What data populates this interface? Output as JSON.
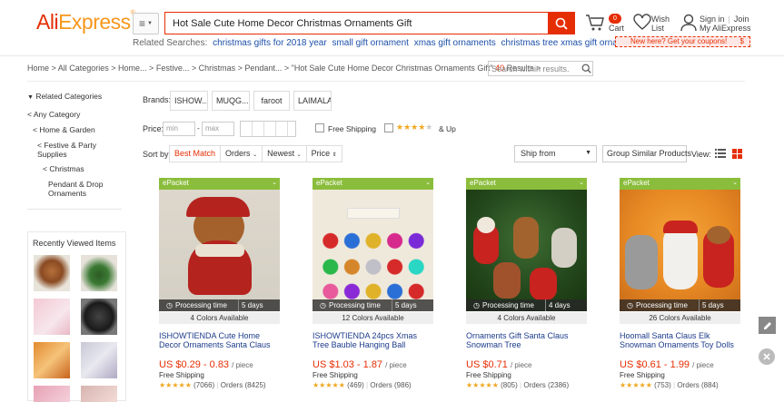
{
  "header": {
    "logo_part1": "Ali",
    "logo_part2": "Express",
    "logo_tm": "®",
    "category_icon": "menu-icon",
    "search_value": "Hot Sale Cute Home Decor Christmas Ornaments Gift",
    "related_label": "Related Searches:",
    "related": [
      "christmas gifts for 2018 year",
      "small gift ornament",
      "xmas gift ornaments",
      "christmas tree xmas gift ornament"
    ],
    "cart_label": "Cart",
    "cart_count": "0",
    "wish_line1": "Wish",
    "wish_line2": "List",
    "sign_in": "Sign in",
    "join": "Join",
    "my_account": "My AliExpress",
    "coupon_text": "New here? Get your coupons!",
    "coupon_symbol": "$"
  },
  "breadcrumb": {
    "path": "Home > All Categories > Home... > Festive... > Christmas > Pendant... > \"Hot Sale Cute Home Decor Christmas Ornaments Gift\"",
    "count": "40",
    "results_label": "Results >",
    "within_placeholder": "Search within results."
  },
  "sidebar": {
    "related_title": "Related Categories",
    "categories": [
      "< Any Category",
      "< Home & Garden",
      "< Festive & Party",
      "Supplies",
      "< Christmas",
      "Pendant & Drop",
      "Ornaments"
    ],
    "recent_title": "Recently Viewed Items"
  },
  "filters": {
    "brands_label": "Brands:",
    "brands": [
      "ISHOW...",
      "MUQG...",
      "faroot",
      "LAIMALA"
    ],
    "price_label": "Price:",
    "min_placeholder": "min",
    "dash": "-",
    "max_placeholder": "max",
    "free_shipping": "Free Shipping",
    "up_label": "& Up",
    "sort_label": "Sort by:",
    "sort_options": [
      "Best Match",
      "Orders",
      "Newest",
      "Price"
    ],
    "ship_from": "Ship from",
    "group_similar": "Group Similar Products",
    "view_label": "View:"
  },
  "products": [
    {
      "badge": "ePacket",
      "processing": "Processing time",
      "days": "5 days",
      "colors": "4 Colors Available",
      "title": "ISHOWTIENDA Cute Home Decor Ornaments Santa Claus",
      "price": "US $0.29 - 0.83",
      "unit": "/ piece",
      "shipping": "Free Shipping",
      "stars": "★★★★★",
      "reviews": "(7066)",
      "orders": "Orders (8425)"
    },
    {
      "badge": "ePacket",
      "processing": "Processing time",
      "days": "5 days",
      "colors": "12 Colors Available",
      "title": "ISHOWTIENDA 24pcs Xmas Tree Bauble Hanging Ball Wedding",
      "price": "US $1.03 - 1.87",
      "unit": "/ piece",
      "shipping": "Free Shipping",
      "stars": "★★★★★",
      "reviews": "(469)",
      "orders": "Orders (986)"
    },
    {
      "badge": "ePacket",
      "processing": "Processing time",
      "days": "4 days",
      "colors": "4 Colors Available",
      "title": "Ornaments Gift Santa Claus Snowman Tree",
      "price": "US $0.71",
      "unit": "/ piece",
      "shipping": "Free Shipping",
      "stars": "★★★★★",
      "reviews": "(805)",
      "orders": "Orders (2386)"
    },
    {
      "badge": "ePacket",
      "processing": "Processing time",
      "days": "5 days",
      "colors": "26 Colors Available",
      "title": "Hoomall Santa Claus Elk Snowman Ornaments Toy Dolls",
      "price": "US $0.61 - 1.99",
      "unit": "/ piece",
      "shipping": "Free Shipping",
      "stars": "★★★★★",
      "reviews": "(753)",
      "orders": "Orders (884)"
    }
  ],
  "colors": {
    "brand_red": "#e62e04",
    "brand_orange": "#f7971d",
    "epacket_green": "#8bbd3c",
    "link_blue": "#1c4fa8"
  },
  "icons": [
    "menu-icon",
    "search-icon",
    "cart-icon",
    "heart-icon",
    "user-icon",
    "list-view-icon",
    "grid-view-icon",
    "edit-icon",
    "close-icon",
    "clock-icon"
  ]
}
